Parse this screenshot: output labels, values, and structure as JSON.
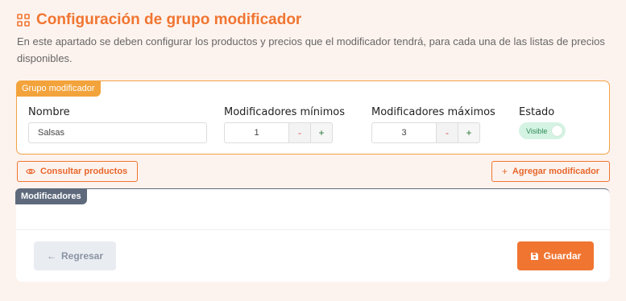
{
  "header": {
    "title": "Configuración de grupo modificador",
    "description": "En este apartado se deben configurar los productos y precios que el modificador tendrá, para cada una de las listas de precios disponibles."
  },
  "group_card": {
    "tag": "Grupo modificador",
    "nombre_label": "Nombre",
    "nombre_value": "Salsas",
    "min_label": "Modificadores mínimos",
    "min_value": "1",
    "max_label": "Modificadores máximos",
    "max_value": "3",
    "minus_label": "-",
    "plus_label": "+",
    "estado_label": "Estado",
    "estado_value": "Visible",
    "estado_on": true
  },
  "actions": {
    "consultar_label": "Consultar productos",
    "agregar_label": "Agregar modificador"
  },
  "mods_card": {
    "tag": "Modificadores",
    "back_label": "Regresar",
    "save_label": "Guardar"
  },
  "colors": {
    "accent": "#f07531",
    "tag_orange": "#f3a33b",
    "tag_slate": "#5e6a7c",
    "toggle_on": "#d5f3e3"
  }
}
